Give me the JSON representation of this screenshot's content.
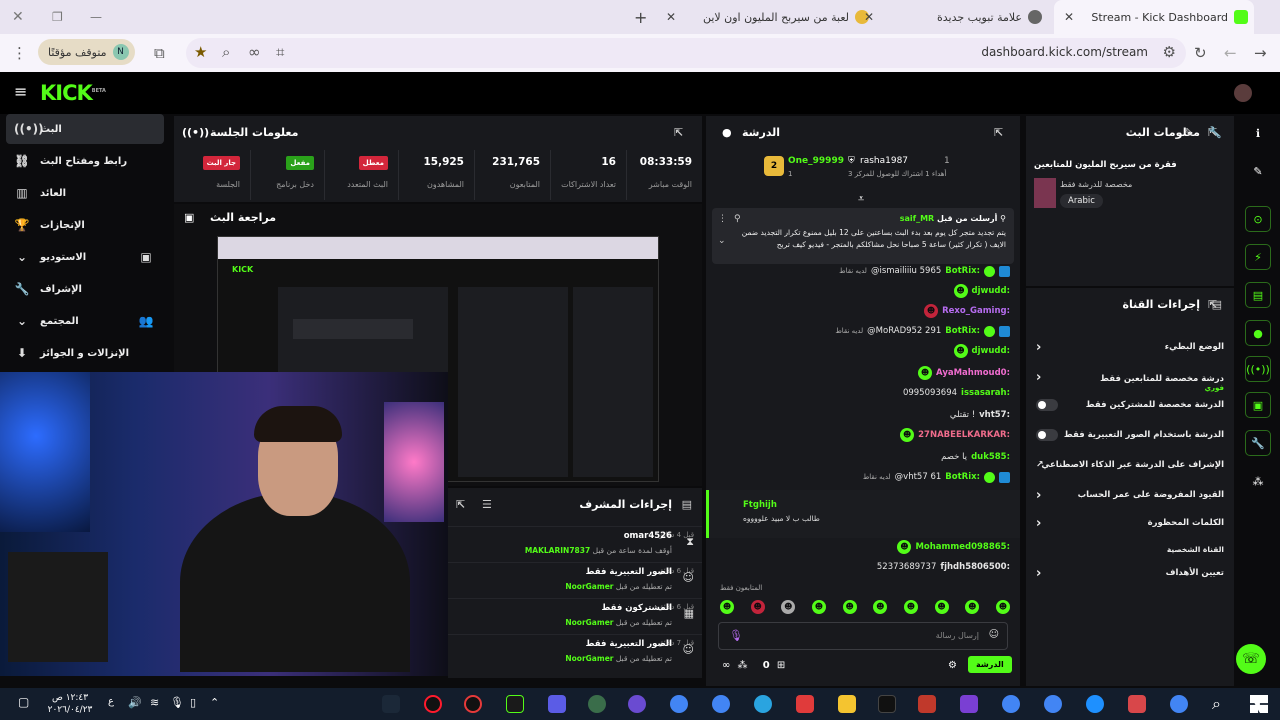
{
  "browser": {
    "tabs": [
      {
        "label": "Stream - Kick Dashboard",
        "fav_color": "#53fc18"
      },
      {
        "label": "علامة تبويب جديدة",
        "fav_color": "#666666"
      },
      {
        "label": "لعبة من سيربح المليون اون لاين",
        "fav_color": "#e8b93a"
      }
    ],
    "url": "dashboard.kick.com/stream",
    "profile_status": "متوقف مؤقتًا",
    "profile_initial": "N"
  },
  "kick": {
    "logo": "KICK",
    "logo_tag": "BETA"
  },
  "sidebar": {
    "items": [
      {
        "label": "البث",
        "icon": "((•))"
      },
      {
        "label": "رابط ومفتاح البث",
        "icon": "⛓"
      },
      {
        "label": "العائد",
        "icon": "▥"
      },
      {
        "label": "الإنجازات",
        "icon": "🏆"
      },
      {
        "label": "الاستوديو",
        "icon": "▣"
      },
      {
        "label": "الإشراف",
        "icon": "🔧"
      },
      {
        "label": "المجتمع",
        "icon": "👥"
      },
      {
        "label": "الإنزالات و الجوائز",
        "icon": "⬇"
      }
    ]
  },
  "session": {
    "title": "معلومات الجلسة",
    "stats": [
      {
        "value": "08:33:59",
        "label": "الوقت مباشر"
      },
      {
        "value": "16",
        "label": "تعداد الاشتراكات"
      },
      {
        "value": "231,765",
        "label": "المتابعون"
      },
      {
        "value": "15,925",
        "label": "المشاهدون"
      },
      {
        "badge": "معطل",
        "label": "البث المتعدد",
        "color": "#d3263b"
      },
      {
        "badge": "مفعل",
        "label": "دخل برنامج",
        "color": "#2aa11a"
      },
      {
        "badge": "جار البث",
        "label": "الجلسة",
        "color": "#d3263b"
      }
    ]
  },
  "review": {
    "title": "مراجعة البث"
  },
  "chat": {
    "title": "الدرشة",
    "leaderboard": {
      "rank1": "1",
      "user1": "rasha1987",
      "user1_sub": "أهداء 1 اشتراك للوصول للمركز 3",
      "rank2": "1",
      "user2": "One_99999",
      "rank_num": "2"
    },
    "pinned_by": "أرسلت من قبل",
    "pinned_user": "saif_MR",
    "pinned_text": "يتم تجديد متجر كل يوم بعد بدء البث بساعتين على 12 بليل ممنوع تكرار التجديد ضمن الايف ( تكرار كثير) ساعة 5 صباحا نحل مشاكلكم بالمتجر - فيديو كيف تربح",
    "messages": [
      {
        "user": "BotRix:",
        "text": "@ismailiiiu 5965",
        "note": "لديه نقاط",
        "color": "#53fc18",
        "bot": true
      },
      {
        "user": "djwudd:",
        "text": "",
        "color": "#53fc18",
        "emote": true
      },
      {
        "user": "Rexo_Gaming:",
        "text": "",
        "color": "#b66cf0",
        "emote": true
      },
      {
        "user": "BotRix:",
        "text": "@MoRAD952 291",
        "note": "لديه نقاط",
        "color": "#53fc18",
        "bot": true
      },
      {
        "user": "djwudd:",
        "text": "",
        "color": "#53fc18",
        "emote": true
      },
      {
        "user": "AyaMahmoud0:",
        "text": "",
        "color": "#f06ccf",
        "emote": true
      },
      {
        "user": "issasarah:",
        "text": "0995093694",
        "color": "#53fc18"
      },
      {
        "user": "vht57:",
        "text": "تقتلي !",
        "color": "#e5e5e5"
      },
      {
        "user": "27NABEELKARKAR:",
        "text": "",
        "color": "#f06c8c",
        "emote": true
      },
      {
        "user": "duk585:",
        "text": "يا خصم",
        "color": "#e5e5e5"
      },
      {
        "user": "BotRix:",
        "text": "@vht57 61",
        "note": "لديه نقاط",
        "color": "#53fc18",
        "bot": true
      }
    ],
    "highlight_user": "Ftghijh",
    "highlight_text": "طالب ب لا مبيد علووووه",
    "messages2": [
      {
        "user": "Mohammed098865:",
        "text": "",
        "color": "#53fc18",
        "emote": true
      },
      {
        "user": "fjhdh5806500:",
        "text": "52373689737",
        "color": "#e5e5e5"
      }
    ],
    "followers_only": "المتابعون فقط",
    "input_placeholder": "إرسال رسالة",
    "send_label": "الدرشة",
    "points": "0"
  },
  "mod_actions": {
    "title": "إجراءات المشرف",
    "rows": [
      {
        "title": "omar4526",
        "desc": "أوقف لمدة ساعة من قبل",
        "actor": "MAKLARIN7837",
        "ago": "قبل 4 دقائق",
        "icon": "⧗"
      },
      {
        "title": "الصور التعبيرية فقط",
        "desc": "تم تعطيله من قبل",
        "actor": "NoorGamer",
        "ago": "قبل 6 دقائق",
        "icon": "☺"
      },
      {
        "title": "المشتركون فقط",
        "desc": "تم تعطيله من قبل",
        "actor": "NoorGamer",
        "ago": "قبل 6 دقائق",
        "icon": "▦"
      },
      {
        "title": "الصور التعبيرية فقط",
        "desc": "تم تعطيله من قبل",
        "actor": "NoorGamer",
        "ago": "قبل 7 دقائق",
        "icon": "☺"
      }
    ]
  },
  "stream_info": {
    "title": "معلومات البث",
    "stream_title": "فقرة من سيربح المليون للمتابعين",
    "subtitle": "مخصصة للدرشة فقط",
    "language": "Arabic"
  },
  "channel_actions": {
    "title": "إجراءات القناة",
    "rows": [
      {
        "label": "الوضع البطيء",
        "kind": "chev"
      },
      {
        "label": "درشة مخصصة للمتابعين فقط",
        "sub": "فوري",
        "kind": "chev"
      },
      {
        "label": "الدرشة مخصصة للمشتركين فقط",
        "kind": "toggle"
      },
      {
        "label": "الدرشة باستخدام الصور التعبيرية فقط",
        "kind": "toggle"
      },
      {
        "label": "الإشراف على الدرشة عبر الذكاء الاصطناعي",
        "kind": "ext"
      },
      {
        "label": "القيود المفروضة على عمر الحساب",
        "kind": "chev"
      },
      {
        "label": "الكلمات المحظورة",
        "kind": "chev"
      }
    ],
    "section": "القناة الشخصية",
    "goals": "تعيين الأهداف"
  },
  "taskbar": {
    "time": "١٢:٤٣ ص",
    "date": "٢٠٢٦/٠٤/٢٣",
    "lang": "ع"
  }
}
